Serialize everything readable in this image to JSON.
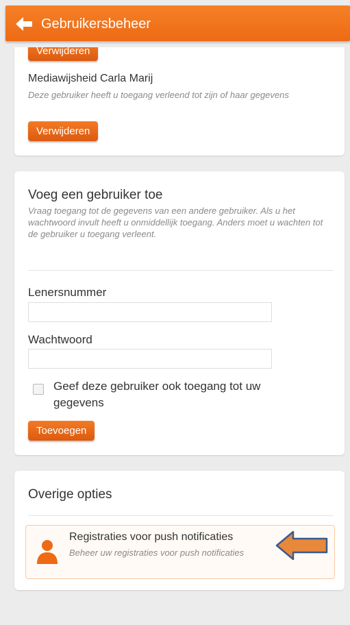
{
  "header": {
    "title": "Gebruikersbeheer",
    "back_icon": "arrow-left-icon",
    "color": "#f07020"
  },
  "users_card": {
    "top_button": "Verwijderen",
    "user": {
      "name": "Mediawijsheid Carla Marij",
      "description": "Deze gebruiker heeft u toegang verleend tot zijn of haar gegevens",
      "button": "Verwijderen"
    }
  },
  "add_user": {
    "heading": "Voeg een gebruiker toe",
    "description": "Vraag toegang tot de gegevens van een andere gebruiker. Als u het wachtwoord invult heeft u onmiddellijk toegang. Anders moet u wachten tot de gebruiker u toegang verleent.",
    "lenersnummer_label": "Lenersnummer",
    "lenersnummer_value": "",
    "wachtwoord_label": "Wachtwoord",
    "wachtwoord_value": "",
    "checkbox_label": "Geef deze gebruiker ook toegang tot uw gegevens",
    "checkbox_checked": false,
    "submit_button": "Toevoegen"
  },
  "other_options": {
    "heading": "Overige opties",
    "items": [
      {
        "icon": "person-icon",
        "title": "Registraties voor push notificaties",
        "subtitle": "Beheer uw registraties voor push notificaties"
      }
    ],
    "annotation_icon": "arrow-left-annotation-icon"
  },
  "colors": {
    "accent": "#ee6a15",
    "background": "#ececec",
    "annotation_fill": "#e8883a",
    "annotation_stroke": "#3a5a8c"
  }
}
